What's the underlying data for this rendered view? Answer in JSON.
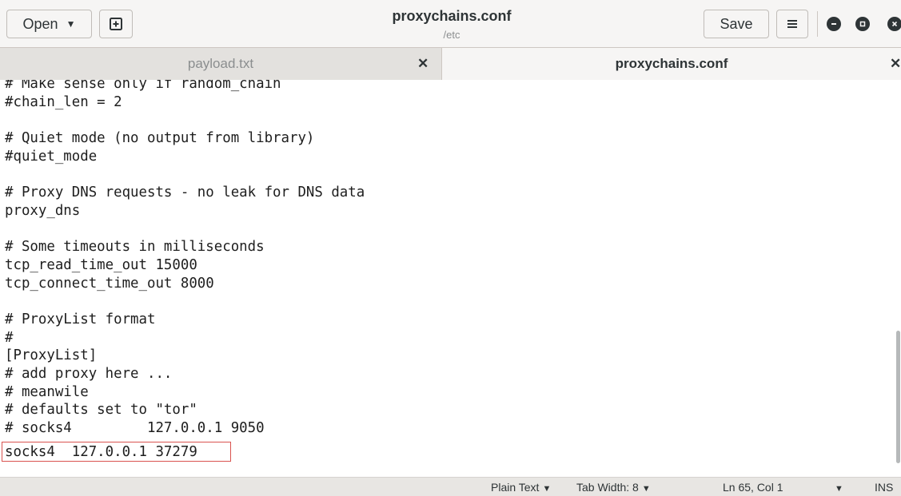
{
  "header": {
    "open_label": "Open",
    "title": "proxychains.conf",
    "subtitle": "/etc",
    "save_label": "Save"
  },
  "tabs": [
    {
      "label": "payload.txt",
      "active": false
    },
    {
      "label": "proxychains.conf",
      "active": true
    }
  ],
  "editor": {
    "lines": [
      "# Make sense only if random_chain",
      "#chain_len = 2",
      "",
      "# Quiet mode (no output from library)",
      "#quiet_mode",
      "",
      "# Proxy DNS requests - no leak for DNS data",
      "proxy_dns",
      "",
      "# Some timeouts in milliseconds",
      "tcp_read_time_out 15000",
      "tcp_connect_time_out 8000",
      "",
      "# ProxyList format",
      "#",
      "[ProxyList]",
      "# add proxy here ...",
      "# meanwile",
      "# defaults set to \"tor\"",
      "# socks4         127.0.0.1 9050",
      "socks4  127.0.0.1 37279"
    ],
    "highlighted_line_index": 20,
    "highlight_color": "#d9534f"
  },
  "statusbar": {
    "language": "Plain Text",
    "tab_width": "Tab Width: 8",
    "position": "Ln 65, Col 1",
    "mode": "INS"
  },
  "icons": {
    "open_dropdown": "chevron-down-icon",
    "new_tab": "new-document-icon",
    "menu": "hamburger-menu-icon",
    "minimize": "minimize-icon",
    "maximize": "maximize-icon",
    "close": "close-icon"
  }
}
